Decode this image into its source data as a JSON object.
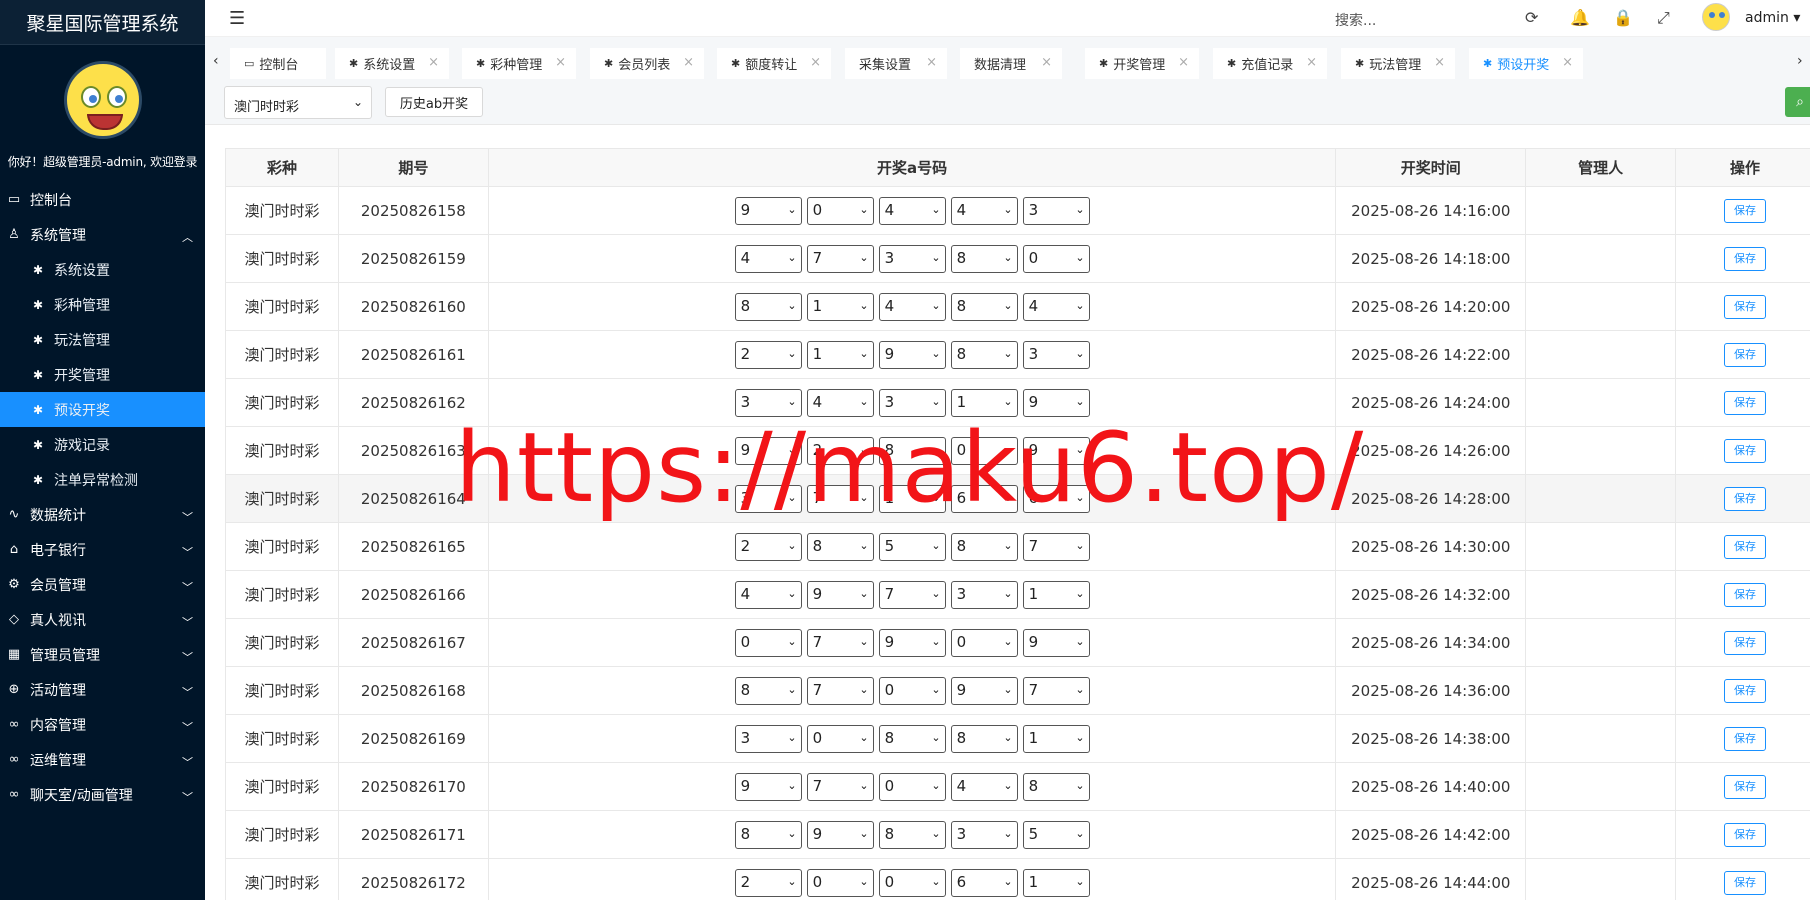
{
  "sidebar": {
    "brand": "聚星国际管理系统",
    "welcome": "你好！超级管理员-admin, 欢迎登录",
    "items": [
      {
        "label": "控制台",
        "icon": "monitor-icon",
        "level": 1,
        "expandable": false
      },
      {
        "label": "系统管理",
        "icon": "user-icon",
        "level": 1,
        "expandable": true,
        "expanded": true
      },
      {
        "label": "系统设置",
        "icon": "palm-icon",
        "level": 2
      },
      {
        "label": "彩种管理",
        "icon": "palm-icon",
        "level": 2
      },
      {
        "label": "玩法管理",
        "icon": "palm-icon",
        "level": 2
      },
      {
        "label": "开奖管理",
        "icon": "palm-icon",
        "level": 2
      },
      {
        "label": "预设开奖",
        "icon": "palm-icon",
        "level": 2,
        "active": true
      },
      {
        "label": "游戏记录",
        "icon": "palm-icon",
        "level": 2
      },
      {
        "label": "注单异常检测",
        "icon": "palm-icon",
        "level": 2
      },
      {
        "label": "数据统计",
        "icon": "pulse-icon",
        "level": 1,
        "expandable": true
      },
      {
        "label": "电子银行",
        "icon": "bank-icon",
        "level": 1,
        "expandable": true
      },
      {
        "label": "会员管理",
        "icon": "gear-icon",
        "level": 1,
        "expandable": true
      },
      {
        "label": "真人视讯",
        "icon": "drop-icon",
        "level": 1,
        "expandable": true
      },
      {
        "label": "管理员管理",
        "icon": "grid-icon",
        "level": 1,
        "expandable": true
      },
      {
        "label": "活动管理",
        "icon": "plus-circle-icon",
        "level": 1,
        "expandable": true
      },
      {
        "label": "内容管理",
        "icon": "infinity-icon",
        "level": 1,
        "expandable": true
      },
      {
        "label": "运维管理",
        "icon": "infinity-icon",
        "level": 1,
        "expandable": true
      },
      {
        "label": "聊天室/动画管理",
        "icon": "infinity-icon",
        "level": 1,
        "expandable": true
      }
    ]
  },
  "topbar": {
    "search_placeholder": "搜索...",
    "user": "admin"
  },
  "tabs": [
    {
      "label": "控制台",
      "icon": "monitor-icon",
      "closable": false
    },
    {
      "label": "系统设置",
      "icon": "palm-icon",
      "closable": true
    },
    {
      "label": "彩种管理",
      "icon": "palm-icon",
      "closable": true
    },
    {
      "label": "会员列表",
      "icon": "palm-icon",
      "closable": true
    },
    {
      "label": "额度转让",
      "icon": "palm-icon",
      "closable": true
    },
    {
      "label": "采集设置",
      "icon": "",
      "closable": true
    },
    {
      "label": "数据清理",
      "icon": "",
      "closable": true
    },
    {
      "label": "开奖管理",
      "icon": "palm-icon",
      "closable": true
    },
    {
      "label": "充值记录",
      "icon": "palm-icon",
      "closable": true
    },
    {
      "label": "玩法管理",
      "icon": "palm-icon",
      "closable": true
    },
    {
      "label": "预设开奖",
      "icon": "palm-icon",
      "closable": true,
      "active": true
    }
  ],
  "controls": {
    "lottery_select": "澳门时时彩",
    "history_button": "历史ab开奖"
  },
  "table": {
    "headers": [
      "彩种",
      "期号",
      "开奖a号码",
      "开奖时间",
      "管理人",
      "操作"
    ],
    "save_label": "保存",
    "rows": [
      {
        "lottery": "澳门时时彩",
        "issue": "20250826158",
        "nums": [
          "9",
          "0",
          "4",
          "4",
          "3"
        ],
        "time": "2025-08-26 14:16:00",
        "manager": ""
      },
      {
        "lottery": "澳门时时彩",
        "issue": "20250826159",
        "nums": [
          "4",
          "7",
          "3",
          "8",
          "0"
        ],
        "time": "2025-08-26 14:18:00",
        "manager": ""
      },
      {
        "lottery": "澳门时时彩",
        "issue": "20250826160",
        "nums": [
          "8",
          "1",
          "4",
          "8",
          "4"
        ],
        "time": "2025-08-26 14:20:00",
        "manager": ""
      },
      {
        "lottery": "澳门时时彩",
        "issue": "20250826161",
        "nums": [
          "2",
          "1",
          "9",
          "8",
          "3"
        ],
        "time": "2025-08-26 14:22:00",
        "manager": ""
      },
      {
        "lottery": "澳门时时彩",
        "issue": "20250826162",
        "nums": [
          "3",
          "4",
          "3",
          "1",
          "9"
        ],
        "time": "2025-08-26 14:24:00",
        "manager": ""
      },
      {
        "lottery": "澳门时时彩",
        "issue": "20250826163",
        "nums": [
          "9",
          "2",
          "8",
          "0",
          "9"
        ],
        "time": "2025-08-26 14:26:00",
        "manager": ""
      },
      {
        "lottery": "澳门时时彩",
        "issue": "20250826164",
        "nums": [
          "3",
          "7",
          "1",
          "6",
          "6"
        ],
        "time": "2025-08-26 14:28:00",
        "manager": "",
        "hover": true
      },
      {
        "lottery": "澳门时时彩",
        "issue": "20250826165",
        "nums": [
          "2",
          "8",
          "5",
          "8",
          "7"
        ],
        "time": "2025-08-26 14:30:00",
        "manager": ""
      },
      {
        "lottery": "澳门时时彩",
        "issue": "20250826166",
        "nums": [
          "4",
          "9",
          "7",
          "3",
          "1"
        ],
        "time": "2025-08-26 14:32:00",
        "manager": ""
      },
      {
        "lottery": "澳门时时彩",
        "issue": "20250826167",
        "nums": [
          "0",
          "7",
          "9",
          "0",
          "9"
        ],
        "time": "2025-08-26 14:34:00",
        "manager": ""
      },
      {
        "lottery": "澳门时时彩",
        "issue": "20250826168",
        "nums": [
          "8",
          "7",
          "0",
          "9",
          "7"
        ],
        "time": "2025-08-26 14:36:00",
        "manager": ""
      },
      {
        "lottery": "澳门时时彩",
        "issue": "20250826169",
        "nums": [
          "3",
          "0",
          "8",
          "8",
          "1"
        ],
        "time": "2025-08-26 14:38:00",
        "manager": ""
      },
      {
        "lottery": "澳门时时彩",
        "issue": "20250826170",
        "nums": [
          "9",
          "7",
          "0",
          "4",
          "8"
        ],
        "time": "2025-08-26 14:40:00",
        "manager": ""
      },
      {
        "lottery": "澳门时时彩",
        "issue": "20250826171",
        "nums": [
          "8",
          "9",
          "8",
          "3",
          "5"
        ],
        "time": "2025-08-26 14:42:00",
        "manager": ""
      },
      {
        "lottery": "澳门时时彩",
        "issue": "20250826172",
        "nums": [
          "2",
          "0",
          "0",
          "6",
          "1"
        ],
        "time": "2025-08-26 14:44:00",
        "manager": ""
      }
    ]
  },
  "watermark": "https://maku6.top/",
  "colors": {
    "sidebar_bg": "#001529",
    "accent": "#1890ff",
    "watermark": "#f21418"
  }
}
